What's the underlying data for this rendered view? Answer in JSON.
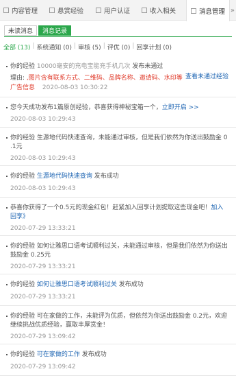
{
  "tabs": [
    {
      "label": "内容管理"
    },
    {
      "label": "悬赏经验"
    },
    {
      "label": "用户认证"
    },
    {
      "label": "收入相关"
    },
    {
      "label": "消息管理"
    }
  ],
  "more_label": "»",
  "subtabs": [
    {
      "label": "未读消息"
    },
    {
      "label": "消息记录"
    }
  ],
  "filters": [
    {
      "label": "全部 (13)"
    },
    {
      "label": "系统通知 (0)"
    },
    {
      "label": "审核 (5)"
    },
    {
      "label": "评优 (0)"
    },
    {
      "label": "回享计划 (0)"
    }
  ],
  "messages": [
    {
      "line1_prefix": "你的经验",
      "line1_gray": "10000毫安的充电宝能充手机几次",
      "line1_suffix": "发布未通过",
      "line1_link": "查看未通过经验",
      "line2_label": "理由:",
      "line2_red": ",图片含有联系方式、二维码、品牌名称、邀请码、水印等",
      "line3_red": "广告信息",
      "line3_time": "2020-08-03 10:30:22"
    },
    {
      "line1_text": "您今天成功发布1篇原创经验，恭喜获得神秘宝箱一个，",
      "line1_link": "立即开启 >>",
      "time": "2020-08-03 10:29:43"
    },
    {
      "line1_text": "你的经验 生源地代码快速查询，未能通过审核，但是我们依然为你送出鼓励金 0",
      "line2_text": ".1元",
      "time": "2020-08-03 10:29:43"
    },
    {
      "line1_prefix": "你的经验",
      "line1_link": "生源地代码快速查询",
      "line1_suffix": "发布成功",
      "time": "2020-08-03 10:29:43"
    },
    {
      "line1_text": "恭喜你获得了一个0.5元的现金红包！赶紧加入回享计划提取这些现金吧！",
      "line1_link": "加入",
      "line2_link": "回享》",
      "time": "2020-07-29 13:33:21"
    },
    {
      "line1_text": "你的经验 如何让雅思口语考试顺利过关，未能通过审核，但是我们依然为你送出",
      "line2_text": "鼓励金 0.25元",
      "time": "2020-07-29 13:33:21"
    },
    {
      "line1_prefix": "你的经验",
      "line1_link": "如何让雅思口语考试顺利过关",
      "line1_suffix": "发布成功",
      "time": "2020-07-29 13:33:21"
    },
    {
      "line1_text": "你的经验 可在家做的工作，未能评为优质，但依然为你送出鼓励金 0.2元，欢迎",
      "line2_text": "继续挑战优质经验，赢取丰厚赏金！",
      "time": "2020-07-29 13:09:42"
    },
    {
      "line1_prefix": "你的经验",
      "line1_link": "可在家做的工作",
      "line1_suffix": "发布成功",
      "time": "2020-07-29 13:09:42"
    }
  ],
  "colors": {
    "accent": "#2ba74b",
    "link": "#1f66b3",
    "error": "#e03c2c",
    "muted": "#999999"
  }
}
